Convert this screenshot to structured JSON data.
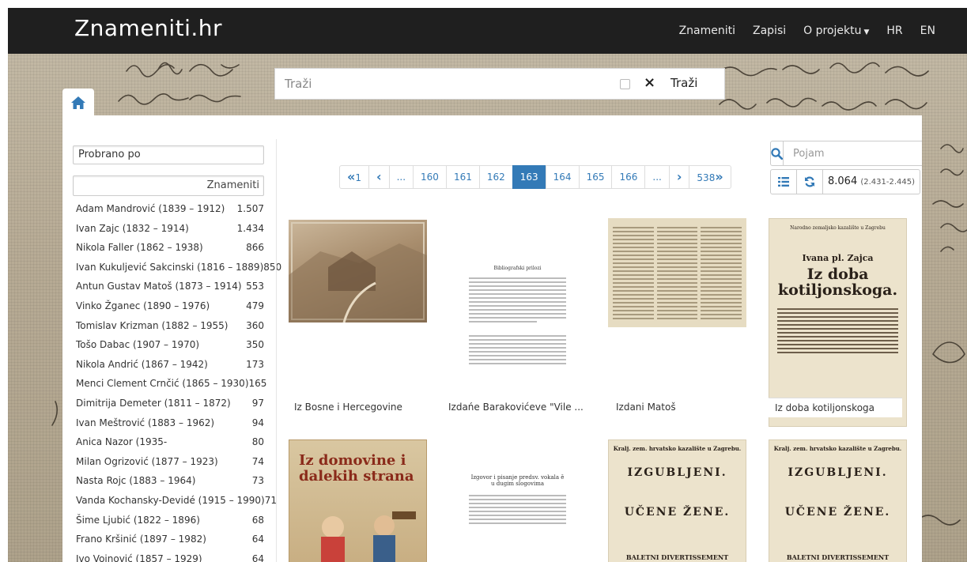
{
  "navbar": {
    "brand": "Znameniti.hr",
    "links": [
      {
        "label": "Znameniti"
      },
      {
        "label": "Zapisi"
      },
      {
        "label": "O projektu"
      },
      {
        "label": "HR"
      },
      {
        "label": "EN"
      }
    ]
  },
  "search": {
    "placeholder": "Traži",
    "submit_label": "Traži",
    "clear_icon": "×"
  },
  "sidebar": {
    "sort_label": "Probrano po",
    "column_header": "Znameniti",
    "people": [
      {
        "name": "Adam Mandrović (1839 – 1912)",
        "count": "1.507"
      },
      {
        "name": "Ivan Zajc (1832 – 1914)",
        "count": "1.434"
      },
      {
        "name": "Nikola Faller (1862 – 1938)",
        "count": "866"
      },
      {
        "name": "Ivan Kukuljević Sakcinski (1816 – 1889)",
        "count": "850"
      },
      {
        "name": "Antun Gustav Matoš (1873 – 1914)",
        "count": "553"
      },
      {
        "name": "Vinko Žganec (1890 – 1976)",
        "count": "479"
      },
      {
        "name": "Tomislav Krizman (1882 – 1955)",
        "count": "360"
      },
      {
        "name": "Tošo Dabac (1907 – 1970)",
        "count": "350"
      },
      {
        "name": "Nikola Andrić (1867 – 1942)",
        "count": "173"
      },
      {
        "name": "Menci Clement Crnčić (1865 – 1930)",
        "count": "165"
      },
      {
        "name": "Dimitrija Demeter (1811 – 1872)",
        "count": "97"
      },
      {
        "name": "Ivan Meštrović (1883 – 1962)",
        "count": "94"
      },
      {
        "name": "Anica Nazor (1935-",
        "count": "80"
      },
      {
        "name": "Milan Ogrizović (1877 – 1923)",
        "count": "74"
      },
      {
        "name": "Nasta Rojc (1883 – 1964)",
        "count": "73"
      },
      {
        "name": "Vanda Kochansky-Devidé (1915 – 1990)",
        "count": "71"
      },
      {
        "name": "Šime Ljubić (1822 – 1896)",
        "count": "68"
      },
      {
        "name": "Frano Kršinić (1897 – 1982)",
        "count": "64"
      },
      {
        "name": "Ivo Vojnović (1857 – 1929)",
        "count": "64"
      }
    ]
  },
  "pagination": {
    "first": "1",
    "pages": [
      "160",
      "161",
      "162",
      "163",
      "164",
      "165",
      "166"
    ],
    "active": "163",
    "ellipsis": "...",
    "last": "538"
  },
  "tools": {
    "term_placeholder": "Pojam",
    "count_main": "8.064",
    "count_range": "(2.431-2.445)"
  },
  "results": [
    {
      "title": "Iz Bosne i Hercegovine"
    },
    {
      "title": "Izdańe Barakovićeve \"Vile ..."
    },
    {
      "title": "Izdani Matoš"
    },
    {
      "title": "Iz doba kotiljonskoga"
    }
  ],
  "posters": {
    "kotiljon_header": "Narodno zemaljsko kazalište u Zagrebu",
    "kotiljon_author": "Ivana pl. Zajca",
    "kotiljon_title": "Iz doba kotiljonskoga.",
    "book_title": "Iz domovine i dalekih strana",
    "izgubljeni_header": "Kralj. zem. hrvatsko kazalište u Zagrebu.",
    "izgubljeni_title": "IZGUBLJENI.",
    "izgubljeni_sub": "UČENE ŽENE.",
    "izgubljeni_footer": "BALETNI DIVERTISSEMENT",
    "doc_title": "Bibliografski prilozi",
    "doc2_title": "Izgovor i pisanje predsv. vokala ě u dugim slogovima"
  },
  "colors": {
    "navbar_bg": "#1f1f1f",
    "accent": "#337ab7"
  }
}
